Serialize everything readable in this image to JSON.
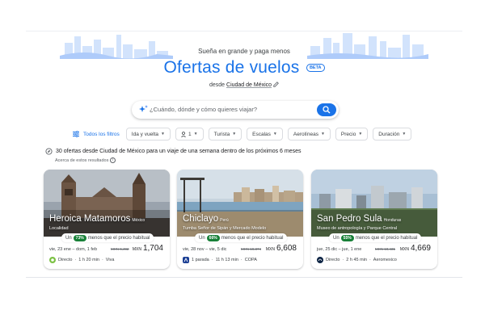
{
  "hero": {
    "tagline": "Sueña en grande y paga menos",
    "title": "Ofertas de vuelos",
    "badge": "BETA",
    "origin_prefix": "desde",
    "origin_city": "Ciudad de México"
  },
  "search": {
    "placeholder": "¿Cuándo, dónde y cómo quieres viajar?"
  },
  "filters": {
    "all": "Todos los filtros",
    "chips": [
      "Ida y vuelta",
      "1",
      "Turista",
      "Escalas",
      "Aerolíneas",
      "Precio",
      "Duración"
    ]
  },
  "results": {
    "summary": "30 ofertas desde Ciudad de México para un viaje de una semana dentro de los próximos 6 meses",
    "about": "Acerca de estos resultados"
  },
  "cards": [
    {
      "city": "Heroica Matamoros",
      "country": "México",
      "subtitle": "Localidad",
      "deal_prefix": "Un",
      "percent": "73%",
      "deal_suffix": "menos que el precio habitual",
      "dates": "vie, 23 ene – dom, 1 feb",
      "old_price": "MXN 6,492",
      "currency": "MXN",
      "price": "1,704",
      "stops": "Directo",
      "duration": "1 h 20 min",
      "airline": "Viva"
    },
    {
      "city": "Chiclayo",
      "country": "Perú",
      "subtitle": "Tumba Señor de Sipán y Mercado Modelo",
      "deal_prefix": "Un",
      "percent": "66%",
      "deal_suffix": "menos que el precio habitual",
      "dates": "vie, 28 nov – vie, 5 dic",
      "old_price": "MXN 19,374",
      "currency": "MXN",
      "price": "6,608",
      "stops": "1 parada",
      "duration": "11 h 13 min",
      "airline": "COPA"
    },
    {
      "city": "San Pedro Sula",
      "country": "Honduras",
      "subtitle": "Museo de antropología y Parque Central",
      "deal_prefix": "Un",
      "percent": "55%",
      "deal_suffix": "menos que el precio habitual",
      "dates": "jue, 25 dic – jue, 1 ene",
      "old_price": "MXN 10,431",
      "currency": "MXN",
      "price": "4,669",
      "stops": "Directo",
      "duration": "2 h 45 min",
      "airline": "Aeromexico"
    }
  ],
  "colors": {
    "accent": "#1a73e8",
    "deal_green": "#188038"
  }
}
